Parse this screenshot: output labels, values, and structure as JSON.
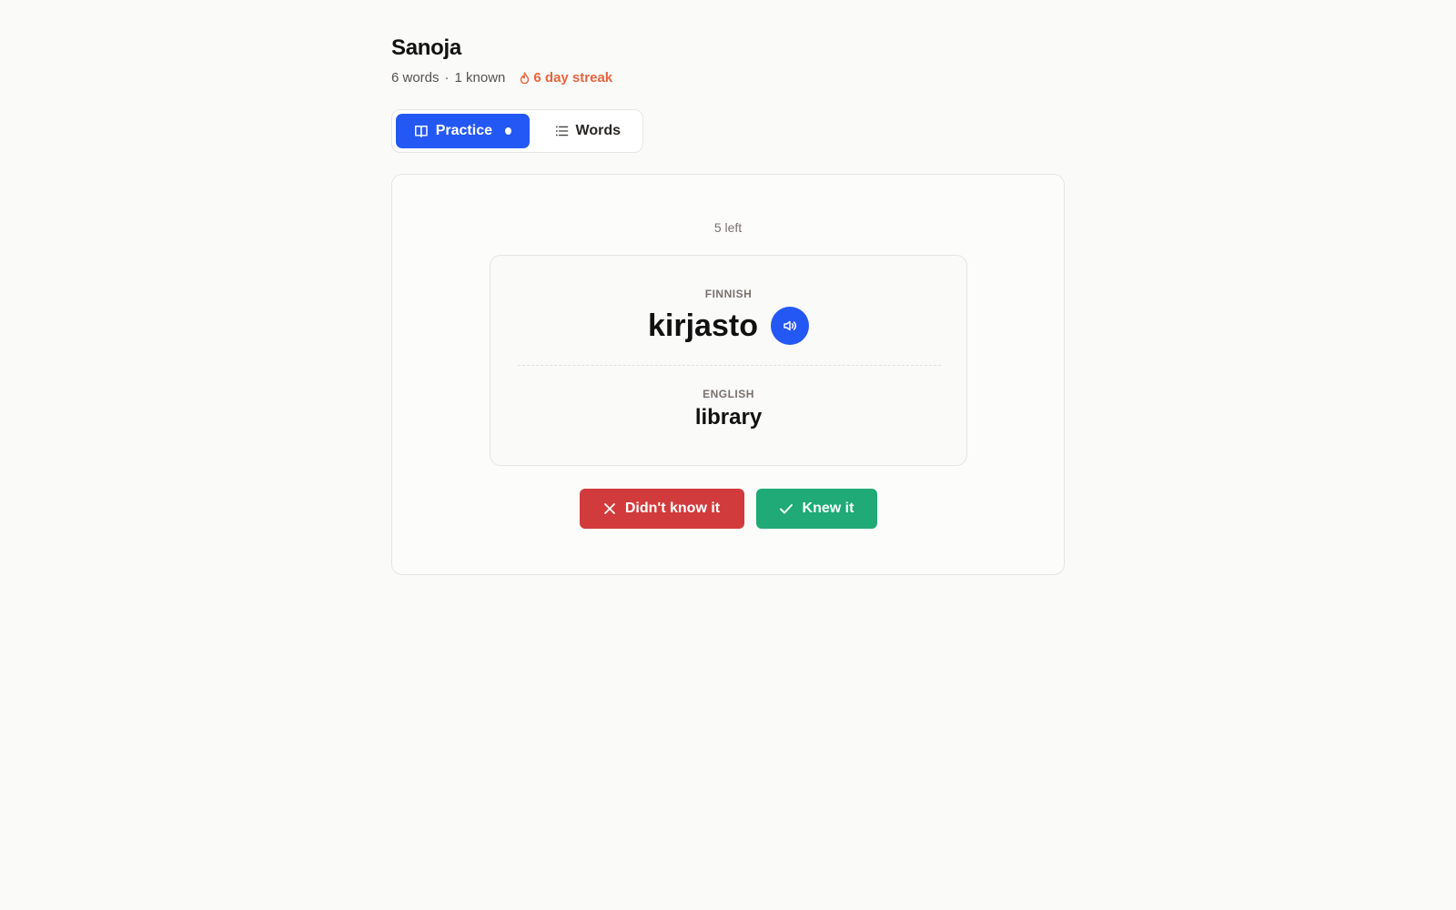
{
  "header": {
    "title": "Sanoja",
    "word_count": "6 words",
    "separator": "·",
    "known_count": "1 known",
    "streak": "6 day streak",
    "streak_icon": "flame-icon"
  },
  "tabs": [
    {
      "label": "Practice",
      "icon": "book-open-icon",
      "active": true
    },
    {
      "label": "Words",
      "icon": "list-icon",
      "active": false
    }
  ],
  "practice": {
    "remaining": "5 left",
    "source_language": "FINNISH",
    "word": "kirjasto",
    "target_language": "ENGLISH",
    "translation": "library",
    "speak_icon": "speaker-icon"
  },
  "actions": {
    "didnt_know": "Didn't know it",
    "knew": "Knew it"
  },
  "colors": {
    "accent": "#2458f5",
    "streak": "#e8643a",
    "danger": "#d23b3b",
    "success": "#1faa77"
  }
}
